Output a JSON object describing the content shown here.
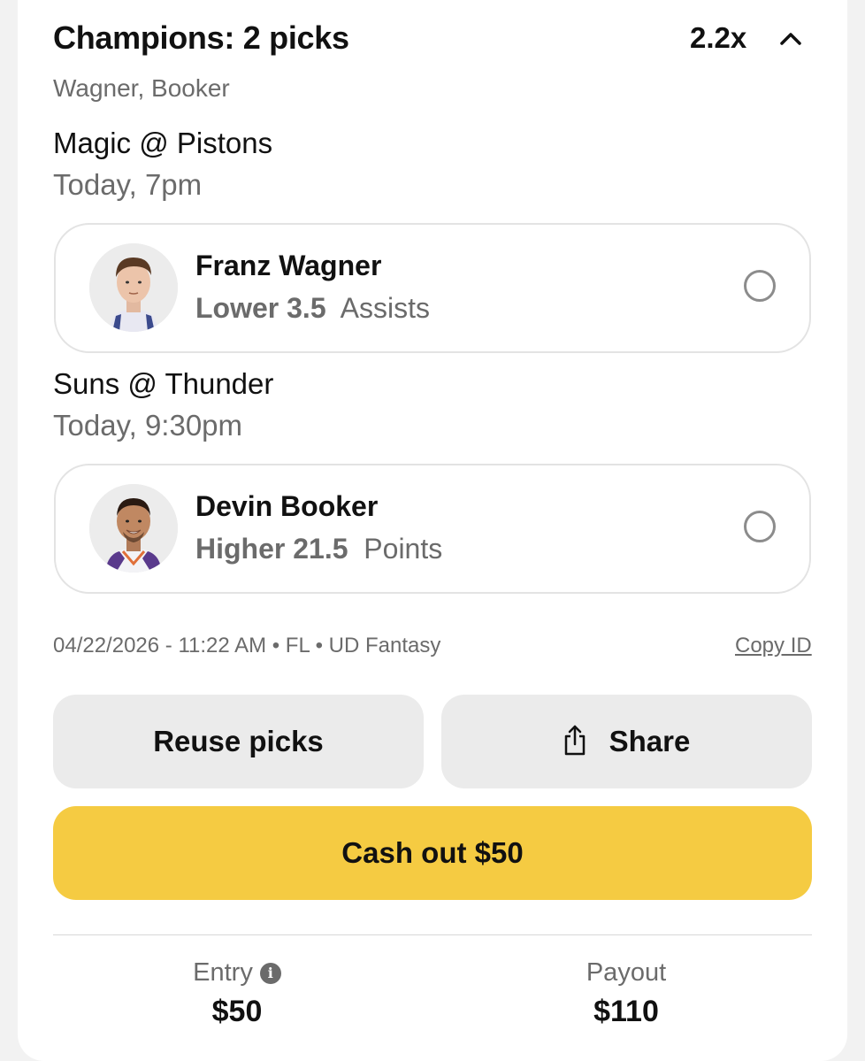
{
  "header": {
    "title": "Champions: 2 picks",
    "multiplier": "2.2x",
    "subtitle": "Wagner, Booker"
  },
  "games": [
    {
      "matchup": "Magic @ Pistons",
      "time": "Today, 7pm",
      "pick": {
        "player": "Franz Wagner",
        "direction_line": "Lower 3.5",
        "stat": "Assists"
      }
    },
    {
      "matchup": "Suns @ Thunder",
      "time": "Today, 9:30pm",
      "pick": {
        "player": "Devin Booker",
        "direction_line": "Higher 21.5",
        "stat": "Points"
      }
    }
  ],
  "meta": {
    "info": "04/22/2026 - 11:22 AM • FL • UD Fantasy",
    "copy_id": "Copy ID"
  },
  "actions": {
    "reuse": "Reuse picks",
    "share": "Share",
    "cash_out": "Cash out $50"
  },
  "summary": {
    "entry_label": "Entry",
    "entry_value": "$50",
    "payout_label": "Payout",
    "payout_value": "$110"
  },
  "icons": {
    "collapse": "chevron-up-icon",
    "share": "share-icon",
    "info": "info-icon",
    "radio": "radio-unselected-icon"
  },
  "colors": {
    "cash_out_bg": "#f5cb42",
    "secondary_button_bg": "#ebebeb",
    "muted_text": "#6b6b6b"
  }
}
